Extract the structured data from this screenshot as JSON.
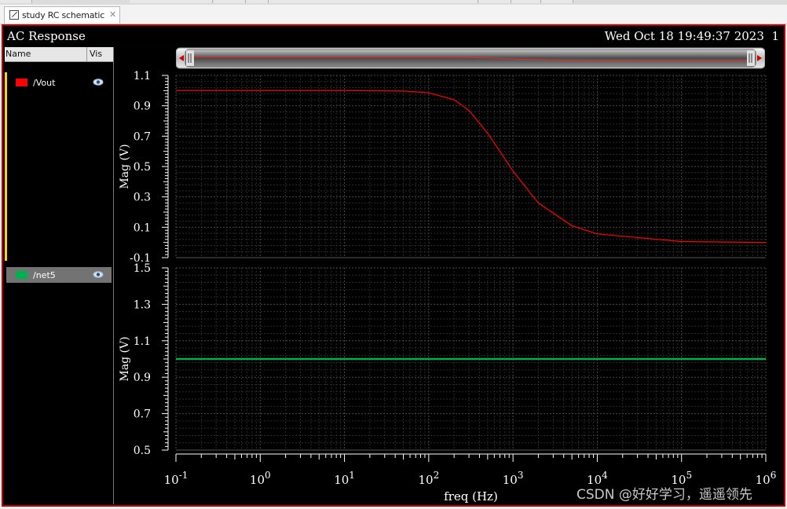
{
  "tab": {
    "label": "study RC schematic",
    "close": "✕"
  },
  "window": {
    "title": "AC Response",
    "datetime": "Wed Oct 18 19:49:37 2023",
    "subwindow": "1"
  },
  "sidebar": {
    "header": {
      "name": "Name",
      "vis": "Vis"
    },
    "signals": [
      {
        "name": "/Vout",
        "color": "#ff0000",
        "icon": "eye-icon"
      },
      {
        "name": "/net5",
        "color": "#00b050",
        "icon": "eye-icon"
      }
    ]
  },
  "chart_data": [
    {
      "type": "line",
      "xscale": "log",
      "xlim": [
        0.1,
        1000000
      ],
      "x_ticks": [
        "10^-1",
        "10^0",
        "10^1",
        "10^2",
        "10^3",
        "10^4",
        "10^5",
        "10^6"
      ],
      "ylabel": "Mag (V)",
      "ylim": [
        -0.1,
        1.1
      ],
      "y_ticks": [
        "1.1",
        "0.9",
        "0.7",
        "0.5",
        "0.3",
        "0.1",
        "-0.1"
      ],
      "grid": true,
      "series": [
        {
          "name": "/Vout",
          "color": "#ff0000",
          "x": [
            0.1,
            1,
            10,
            50,
            100,
            200,
            300,
            500,
            700,
            1000,
            2000,
            5000,
            10000,
            100000,
            1000000
          ],
          "y": [
            1.0,
            1.0,
            1.0,
            0.997,
            0.985,
            0.94,
            0.87,
            0.72,
            0.6,
            0.47,
            0.26,
            0.11,
            0.056,
            0.006,
            0.0006
          ]
        }
      ]
    },
    {
      "type": "line",
      "xscale": "log",
      "xlim": [
        0.1,
        1000000
      ],
      "x_ticks": [
        "10^-1",
        "10^0",
        "10^1",
        "10^2",
        "10^3",
        "10^4",
        "10^5",
        "10^6"
      ],
      "xlabel": "freq (Hz)",
      "ylabel": "Mag (V)",
      "ylim": [
        0.5,
        1.5
      ],
      "y_ticks": [
        "1.5",
        "1.3",
        "1.1",
        "0.9",
        "0.7",
        "0.5"
      ],
      "grid": true,
      "series": [
        {
          "name": "/net5",
          "color": "#00b050",
          "x": [
            0.1,
            1000000
          ],
          "y": [
            1.0,
            1.0
          ]
        }
      ]
    }
  ],
  "watermark": "CSDN @好好学习，遥遥领先"
}
